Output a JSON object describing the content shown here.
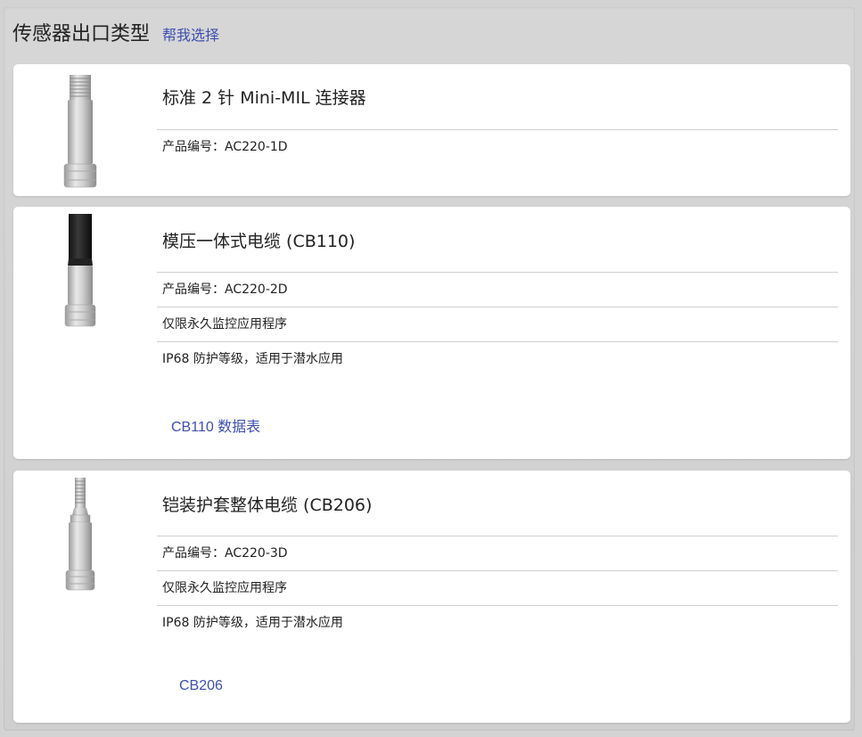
{
  "header": {
    "title": "传感器出口类型",
    "help_link": "帮我选择"
  },
  "products": [
    {
      "name": "标准 2 针 Mini-MIL 连接器",
      "part_number": "产品编号：AC220-1D",
      "thumb_icon": "connector-icon"
    },
    {
      "name": "模压一体式电缆 (CB110)",
      "part_number": "产品编号：AC220-2D",
      "note1": "仅限永久监控应用程序",
      "note2": "IP68 防护等级，适用于潜水应用",
      "link": "CB110 数据表",
      "thumb_icon": "molded-cable-icon"
    },
    {
      "name": "铠装护套整体电缆 (CB206)",
      "part_number": "产品编号：AC220-3D",
      "note1": "仅限永久监控应用程序",
      "note2": "IP68 防护等级，适用于潜水应用",
      "link": "CB206",
      "thumb_icon": "armored-cable-icon"
    }
  ]
}
